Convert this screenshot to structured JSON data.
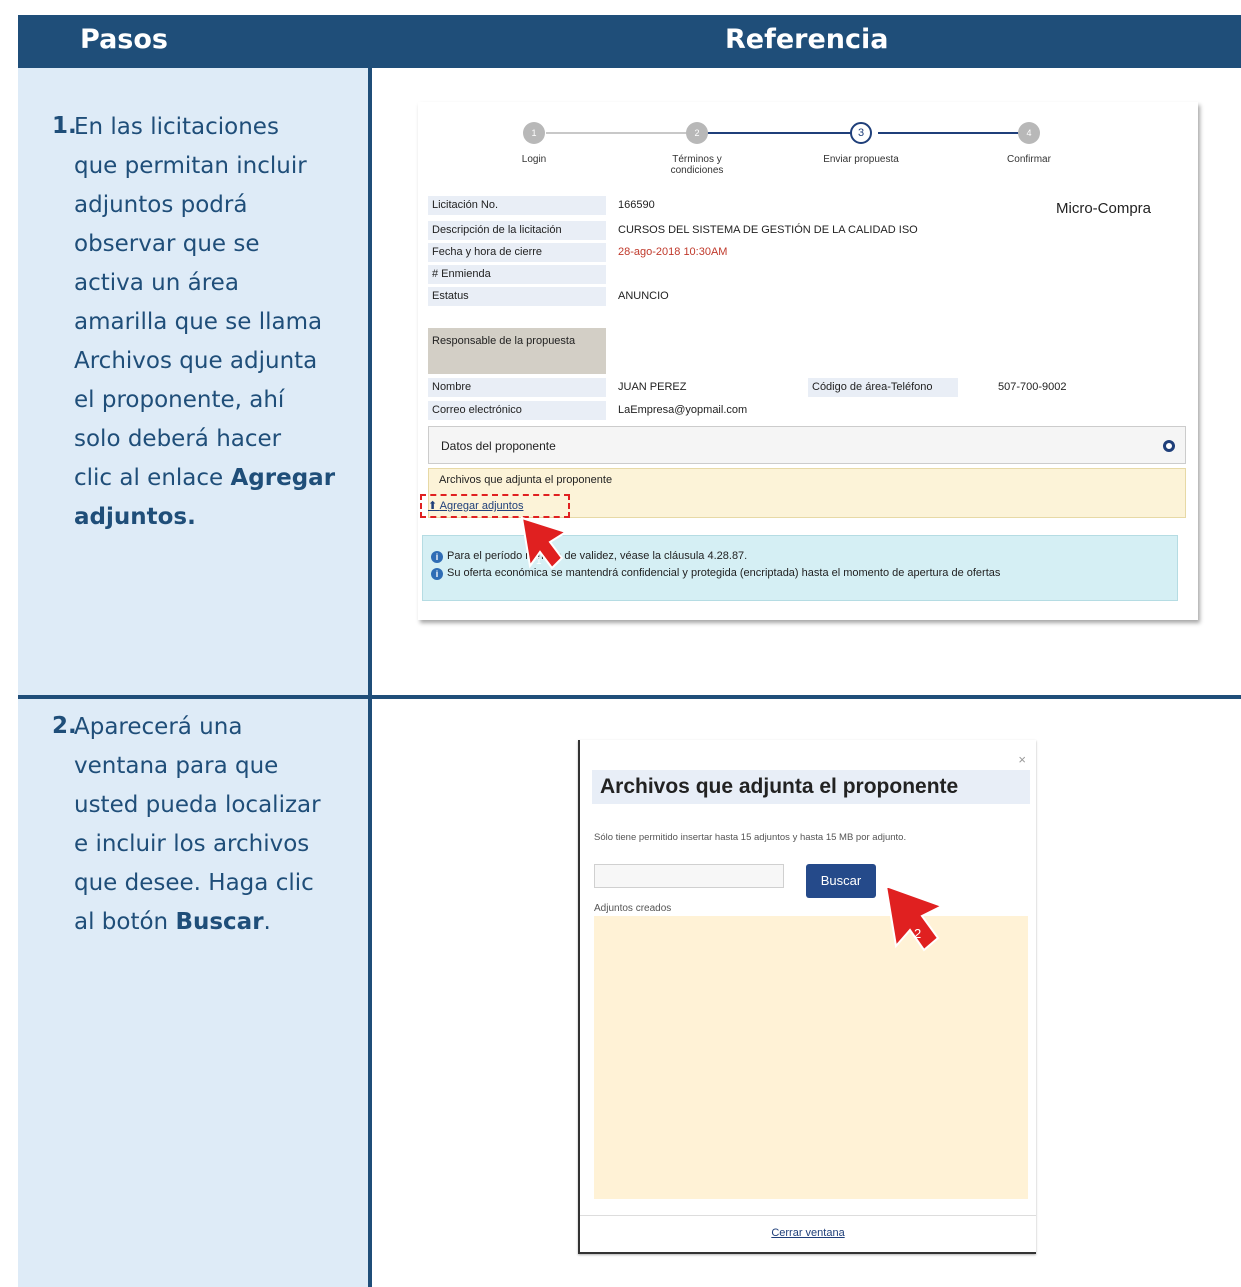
{
  "header": {
    "col1": "Pasos",
    "col2": "Referencia"
  },
  "steps": [
    {
      "num": "1.",
      "lines": [
        "En las licitaciones",
        "que permitan incluir",
        "adjuntos podrá",
        "observar que se",
        "activa un área",
        "amarilla que se llama",
        "Archivos que adjunta",
        "el proponente, ahí",
        "solo deberá hacer"
      ],
      "line10_pre": "clic al enlace ",
      "line10_bold": "Agregar",
      "line11_bold": "adjuntos."
    },
    {
      "num": "2.",
      "lines": [
        "Aparecerá una",
        "ventana para que",
        "usted pueda localizar",
        "e incluir los archivos",
        "que desee. Haga clic"
      ],
      "line6_pre": "al botón ",
      "line6_bold": "Buscar",
      "line6_post": "."
    }
  ],
  "wizard": {
    "steps": [
      {
        "n": "1",
        "label": "Login"
      },
      {
        "n": "2",
        "label": "Términos y condiciones"
      },
      {
        "n": "3",
        "label": "Enviar propuesta"
      },
      {
        "n": "4",
        "label": "Confirmar"
      }
    ],
    "active": 3
  },
  "form": {
    "micro": "Micro-Compra",
    "rows": [
      {
        "label": "Licitación No.",
        "value": "166590"
      },
      {
        "label": "Descripción de la licitación",
        "value": "CURSOS DEL SISTEMA DE GESTIÓN DE LA CALIDAD ISO"
      },
      {
        "label": "Fecha y hora de cierre",
        "value": "28-ago-2018 10:30AM"
      },
      {
        "label": "# Enmienda",
        "value": ""
      },
      {
        "label": "Estatus",
        "value": "ANUNCIO"
      }
    ],
    "responsable": "Responsable de la propuesta",
    "nombre_label": "Nombre",
    "nombre": "JUAN PEREZ",
    "tel_label": "Código de área-Teléfono",
    "tel": "507-700-9002",
    "correo_label": "Correo electrónico",
    "correo": "LaEmpresa@yopmail.com",
    "datos": "Datos del proponente",
    "archivos": "Archivos que adjunta el proponente",
    "agregar": "Agregar adjuntos",
    "info1": "Para el período mínimo de validez, véase la cláusula 4.28.87.",
    "info2": "Su oferta económica se mantendrá confidencial y protegida (encriptada) hasta el momento de apertura de ofertas",
    "colors": {
      "accent": "#1f4e79",
      "red": "#c0392b"
    }
  },
  "modal": {
    "close": "×",
    "title": "Archivos que adjunta el proponente",
    "note": "Sólo tiene permitido insertar hasta 15 adjuntos y hasta 15 MB por adjunto.",
    "button": "Buscar",
    "adjuntos_label": "Adjuntos creados",
    "footer_link": "Cerrar ventana"
  },
  "cursors": [
    {
      "badge": "1",
      "icon": "red-cursor-icon"
    },
    {
      "badge": "2",
      "icon": "red-cursor-icon"
    }
  ]
}
